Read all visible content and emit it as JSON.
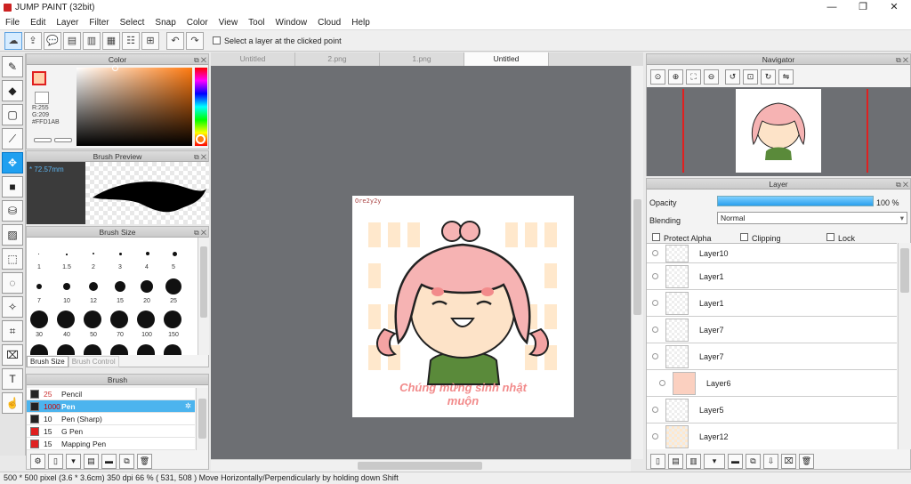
{
  "window": {
    "title": "JUMP PAINT (32bit)",
    "minimize": "—",
    "maximize": "❐",
    "close": "✕"
  },
  "menu": [
    "File",
    "Edit",
    "Layer",
    "Filter",
    "Select",
    "Snap",
    "Color",
    "View",
    "Tool",
    "Window",
    "Cloud",
    "Help"
  ],
  "toolbar": {
    "select_layer_label": "Select a layer at the clicked point"
  },
  "tabs": [
    {
      "label": "Untitled"
    },
    {
      "label": "2.png"
    },
    {
      "label": "1.png"
    },
    {
      "label": "Untitled",
      "active": true
    }
  ],
  "color_panel": {
    "title": "Color",
    "r": "R:255",
    "g": "G:209",
    "hex": "#FFD1AB",
    "current_color": "#ffd1ab"
  },
  "brush_preview": {
    "title": "Brush Preview",
    "size": "* 72.57mm"
  },
  "brush_size": {
    "title": "Brush Size",
    "sizes": [
      "1",
      "1.5",
      "2",
      "3",
      "4",
      "5",
      "7",
      "10",
      "12",
      "15",
      "20",
      "25",
      "30",
      "40",
      "50",
      "70",
      "100",
      "150"
    ],
    "tab_active": "Brush Size",
    "tab_inactive": "Brush Control"
  },
  "brush_panel": {
    "title": "Brush",
    "items": [
      {
        "size": "25",
        "name": "Pencil",
        "color": "#222222"
      },
      {
        "size": "1000",
        "name": "Pen",
        "color": "#222222",
        "selected": true
      },
      {
        "size": "10",
        "name": "Pen (Sharp)",
        "color": "#222222"
      },
      {
        "size": "15",
        "name": "G Pen",
        "color": "#e02020"
      },
      {
        "size": "15",
        "name": "Mapping Pen",
        "color": "#e02020"
      }
    ]
  },
  "artwork": {
    "signature": "Ore2y2y",
    "text_line1": "Chúng mừng sinh nhật",
    "text_line2": "muộn"
  },
  "navigator": {
    "title": "Navigator"
  },
  "layer_panel": {
    "title": "Layer",
    "opacity_label": "Opacity",
    "opacity_value": "100 %",
    "opacity_fraction": 1.0,
    "blending_label": "Blending",
    "blending_value": "Normal",
    "protect_alpha": "Protect Alpha",
    "clipping": "Clipping",
    "lock": "Lock",
    "layers": [
      {
        "name": "Layer10"
      },
      {
        "name": "Layer1"
      },
      {
        "name": "Layer1"
      },
      {
        "name": "Layer7"
      },
      {
        "name": "Layer7"
      },
      {
        "name": "Layer6",
        "selected": true
      },
      {
        "name": "Layer5"
      },
      {
        "name": "Layer12"
      }
    ]
  },
  "status": {
    "text": "500 * 500 pixel  (3.6 * 3.6cm)   350 dpi   66 %   ( 531, 508 )   Move Horizontally/Perpendicularly by holding down Shift"
  }
}
